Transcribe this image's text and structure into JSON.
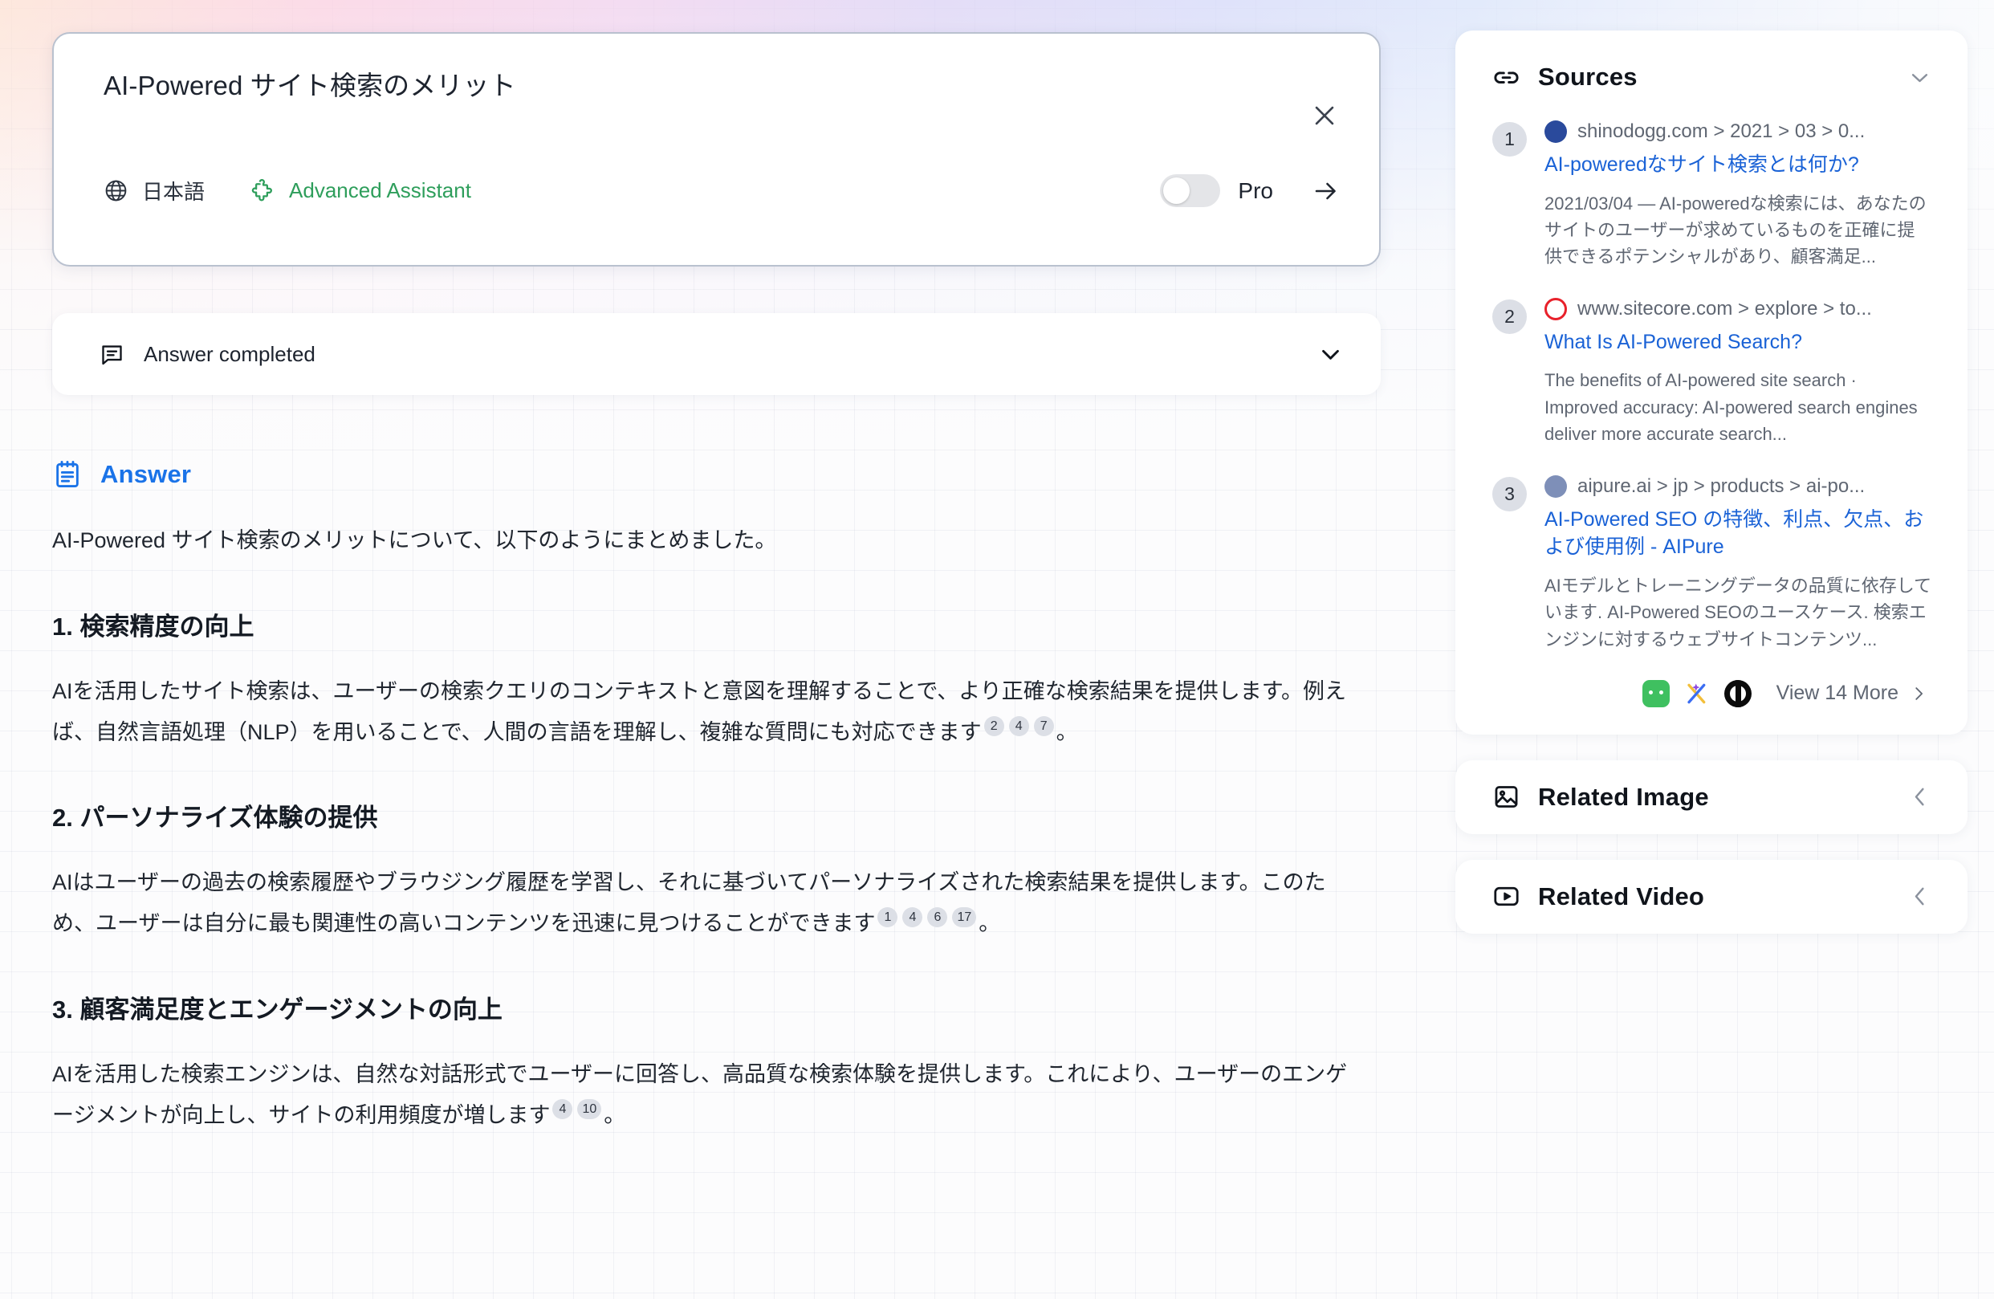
{
  "query": {
    "text": "AI-Powered サイト検索のメリット",
    "language": "日本語",
    "assistant": "Advanced Assistant",
    "pro_label": "Pro",
    "pro_enabled": false
  },
  "status": {
    "label": "Answer completed"
  },
  "answer": {
    "header": "Answer",
    "intro": "AI-Powered サイト検索のメリットについて、以下のようにまとめました。",
    "sections": [
      {
        "heading": "1. 検索精度の向上",
        "body_before": "AIを活用したサイト検索は、ユーザーの検索クエリのコンテキストと意図を理解することで、より正確な検索結果を提供します。例えば、自然言語処理（NLP）を用いることで、人間の言語を理解し、複雑な質問にも対応できます",
        "citations": [
          "2",
          "4",
          "7"
        ],
        "body_after": "。"
      },
      {
        "heading": "2. パーソナライズ体験の提供",
        "body_before": "AIはユーザーの過去の検索履歴やブラウジング履歴を学習し、それに基づいてパーソナライズされた検索結果を提供します。このため、ユーザーは自分に最も関連性の高いコンテンツを迅速に見つけることができます",
        "citations": [
          "1",
          "4",
          "6",
          "17"
        ],
        "body_after": "。"
      },
      {
        "heading": "3. 顧客満足度とエンゲージメントの向上",
        "body_before": "AIを活用した検索エンジンは、自然な対話形式でユーザーに回答し、高品質な検索体験を提供します。これにより、ユーザーのエンゲージメントが向上し、サイトの利用頻度が増します",
        "citations": [
          "4",
          "10"
        ],
        "body_after": "。"
      }
    ]
  },
  "sources": {
    "title": "Sources",
    "items": [
      {
        "number": "1",
        "domain": "shinodogg.com > 2021 > 03 > 0...",
        "title": "AI-poweredなサイト検索とは何か?",
        "snippet": "2021/03/04 — AI-poweredな検索には、あなたのサイトのユーザーが求めているものを正確に提供できるポテンシャルがあり、顧客満足...",
        "favicon_color": "#2a4a9c"
      },
      {
        "number": "2",
        "domain": "www.sitecore.com > explore > to...",
        "title": "What Is AI-Powered Search?",
        "snippet": "The benefits of AI-powered site search · Improved accuracy: AI-powered search engines deliver more accurate search...",
        "favicon_color": "#e8212b"
      },
      {
        "number": "3",
        "domain": "aipure.ai > jp > products > ai-po...",
        "title": "AI-Powered SEO の特徴、利点、欠点、および使用例 - AIPure",
        "snippet": "AIモデルとトレーニングデータの品質に依存しています. AI-Powered SEOのユースケース. 検索エンジンに対するウェブサイトコンテンツ...",
        "favicon_color": "#7e8fb8"
      }
    ],
    "footer_icons": [
      "green-chat-icon",
      "x-sparkle-icon",
      "black-circle-icon"
    ],
    "view_more_label": "View 14 More"
  },
  "related_image": {
    "title": "Related Image"
  },
  "related_video": {
    "title": "Related Video"
  },
  "colors": {
    "link_blue": "#1a62d6",
    "answer_blue": "#1a73e8",
    "assistant_green": "#2e9e5b",
    "citation_bg": "#dcdfe6"
  }
}
